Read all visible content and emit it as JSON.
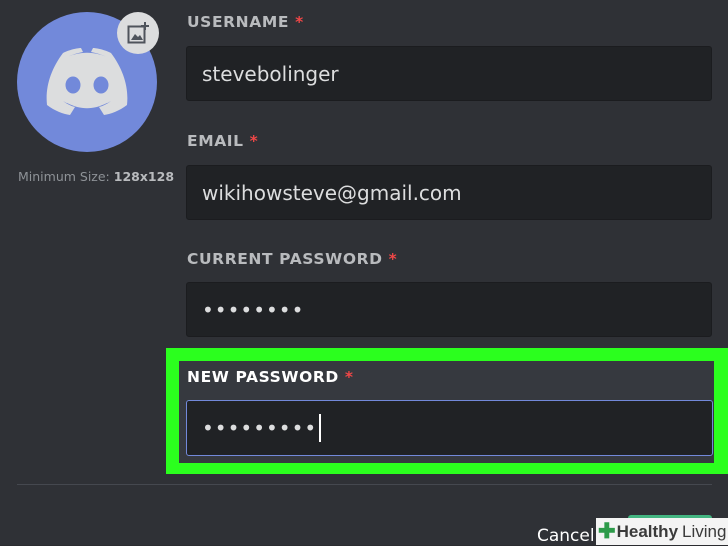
{
  "avatar": {
    "min_size_label": "Minimum Size:",
    "min_size_value": "128x128",
    "icon": "discord-logo-icon",
    "upload_icon": "image-add-icon",
    "color": "#7289da"
  },
  "fields": {
    "username": {
      "label": "USERNAME",
      "required": "*",
      "value": "stevebolinger"
    },
    "email": {
      "label": "EMAIL",
      "required": "*",
      "value": "wikihowsteve@gmail.com"
    },
    "current_password": {
      "label": "CURRENT PASSWORD",
      "required": "*",
      "value": "••••••••"
    },
    "new_password": {
      "label": "NEW PASSWORD",
      "required": "*",
      "value": "•••••••••"
    }
  },
  "footer": {
    "cancel_label": "Cancel"
  },
  "watermark": {
    "word1": "Healthy",
    "word2": "Living"
  },
  "colors": {
    "highlight": "#2bff1e",
    "required": "#f04747",
    "save": "#43b581"
  }
}
